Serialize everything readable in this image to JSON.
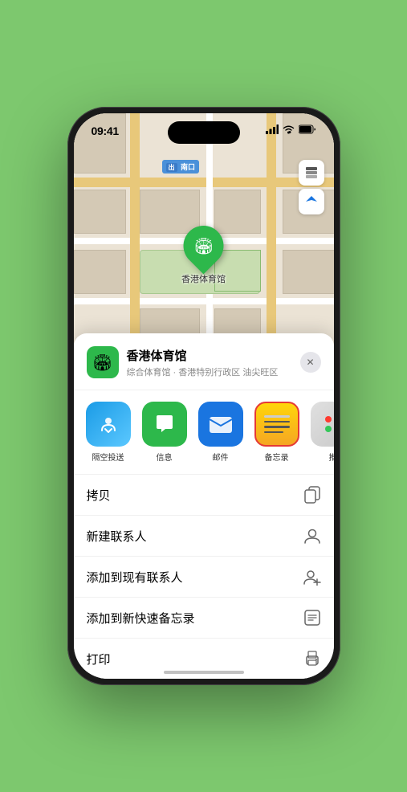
{
  "status_bar": {
    "time": "09:41",
    "signal": "●●●●",
    "wifi": "wifi",
    "battery": "battery"
  },
  "map": {
    "label": "南口",
    "label_prefix": "出入口"
  },
  "map_controls": {
    "layers_icon": "🗺",
    "location_icon": "⊕"
  },
  "marker": {
    "label": "香港体育馆"
  },
  "place_header": {
    "name": "香港体育馆",
    "description": "综合体育馆 · 香港特别行政区 油尖旺区",
    "close_label": "✕"
  },
  "share_items": [
    {
      "id": "airdrop",
      "label": "隔空投送",
      "type": "airdrop"
    },
    {
      "id": "messages",
      "label": "信息",
      "type": "messages"
    },
    {
      "id": "mail",
      "label": "邮件",
      "type": "mail"
    },
    {
      "id": "notes",
      "label": "备忘录",
      "type": "notes"
    },
    {
      "id": "more",
      "label": "推",
      "type": "more"
    }
  ],
  "action_items": [
    {
      "id": "copy",
      "label": "拷贝",
      "icon": "copy"
    },
    {
      "id": "new-contact",
      "label": "新建联系人",
      "icon": "person"
    },
    {
      "id": "add-contact",
      "label": "添加到现有联系人",
      "icon": "person-add"
    },
    {
      "id": "quick-note",
      "label": "添加到新快速备忘录",
      "icon": "note"
    },
    {
      "id": "print",
      "label": "打印",
      "icon": "printer"
    }
  ]
}
